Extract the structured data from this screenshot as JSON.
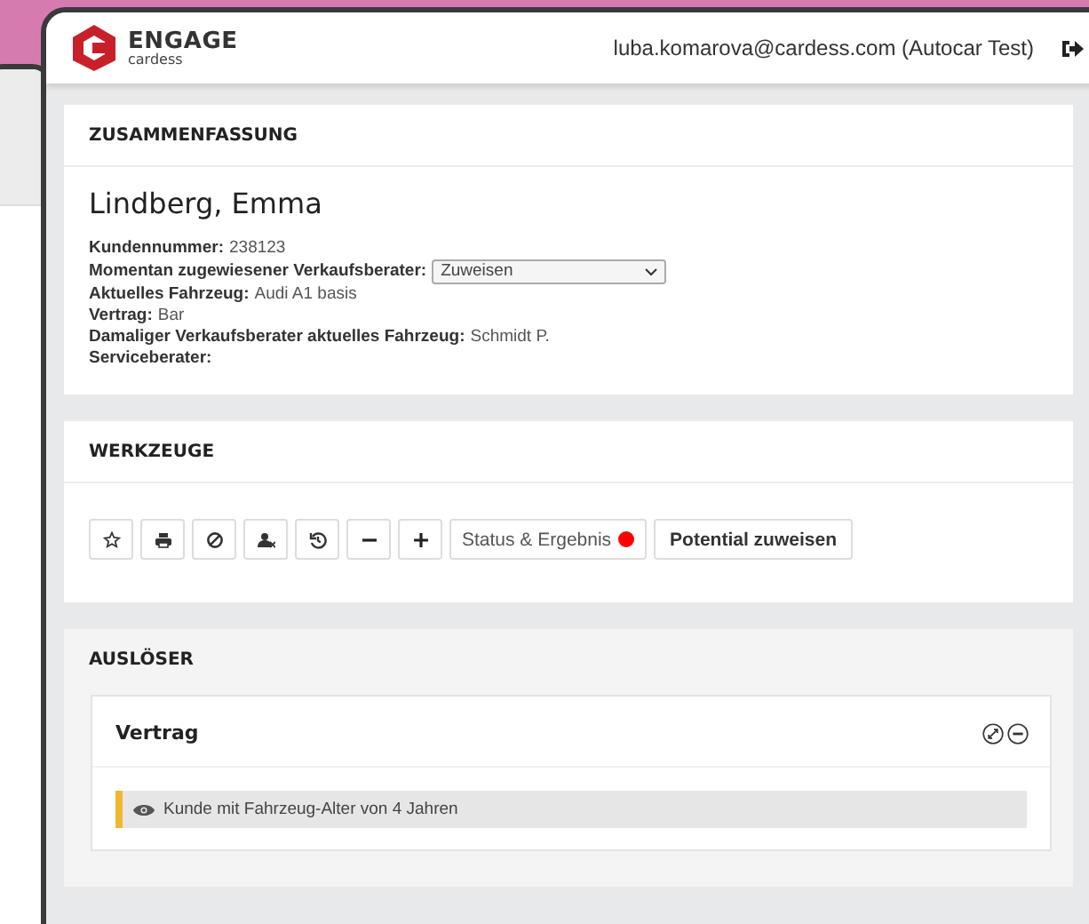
{
  "header": {
    "logo": {
      "name": "ENGAGE",
      "brand": "cardess"
    },
    "user": "luba.komarova@cardess.com (Autocar Test)"
  },
  "summary": {
    "title": "ZUSAMMENFASSUNG",
    "customer": "Lindberg, Emma",
    "fields": [
      {
        "kind": "text",
        "label": "Kundennummer:",
        "value": "238123"
      },
      {
        "kind": "select",
        "label": "Momentan zugewiesener Verkaufsberater:",
        "value": "Zuweisen"
      },
      {
        "kind": "text",
        "label": "Aktuelles Fahrzeug:",
        "value": "Audi A1 basis"
      },
      {
        "kind": "text",
        "label": "Vertrag:",
        "value": "Bar"
      },
      {
        "kind": "text",
        "label": "Damaliger Verkaufsberater aktuelles Fahrzeug:",
        "value": "Schmidt P."
      },
      {
        "kind": "text",
        "label": "Serviceberater:"
      }
    ]
  },
  "tools": {
    "title": "WERKZEUGE",
    "buttons": [
      {
        "kind": "star"
      },
      {
        "kind": "print"
      },
      {
        "kind": "ban"
      },
      {
        "kind": "user-x"
      },
      {
        "kind": "history"
      },
      {
        "kind": "minus"
      },
      {
        "kind": "plus"
      },
      {
        "kind": "status",
        "label": "Status & Ergebnis",
        "color": "#ff0000"
      },
      {
        "kind": "primary",
        "label": "Potential zuweisen"
      }
    ]
  },
  "triggers": {
    "title": "AUSLÖSER",
    "panels": [
      {
        "title": "Vertrag",
        "items": [
          "Kunde mit Fahrzeug-Alter von 4 Jahren"
        ]
      }
    ]
  }
}
